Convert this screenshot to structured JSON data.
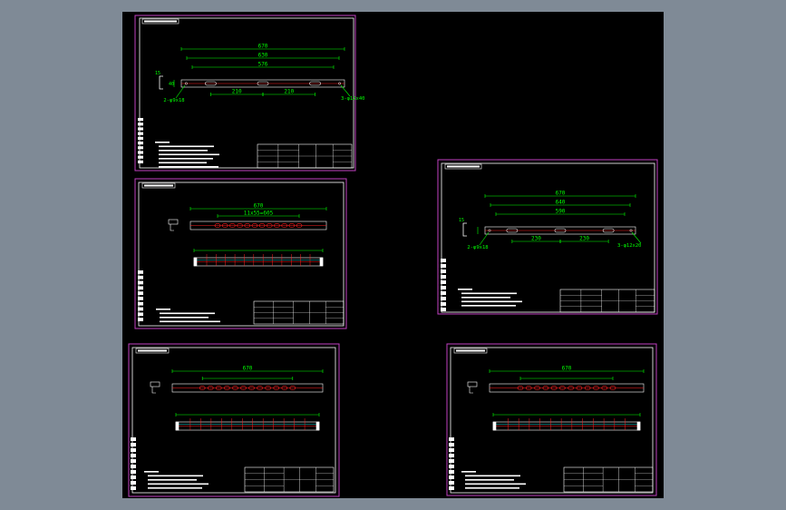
{
  "colors": {
    "background": "#7f8a96",
    "modelspace": "#000000",
    "sheet_border": "#c040c0",
    "frame": "#ffffff",
    "dimension": "#00ff00",
    "centerline": "#ff2020",
    "outline": "#ffffff",
    "hidden": "#00ffff"
  },
  "sheets": [
    {
      "name": "sheet-top-left",
      "type": "detail",
      "dims": {
        "overall": "670",
        "mid": "630",
        "inner": "576",
        "spacing_a": "210",
        "spacing_b": "210",
        "height": "40",
        "thickness": "15",
        "hole_a": "2-φ9x18",
        "hole_b": "3-φ12x40"
      }
    },
    {
      "name": "sheet-mid-left",
      "type": "assembly",
      "dims": {
        "overall": "670",
        "spacing": "11x55=605"
      }
    },
    {
      "name": "sheet-right",
      "type": "detail",
      "dims": {
        "overall": "670",
        "mid": "640",
        "inner": "590",
        "spacing_a": "230",
        "spacing_b": "230",
        "height": "",
        "thickness": "15",
        "hole_a": "2-φ9x18",
        "hole_b": "3-φ12x20"
      }
    },
    {
      "name": "sheet-bottom-left",
      "type": "assembly",
      "dims": {
        "overall": "670",
        "spacing": ""
      }
    },
    {
      "name": "sheet-bottom-right",
      "type": "assembly",
      "dims": {
        "overall": "670",
        "spacing": ""
      }
    }
  ]
}
